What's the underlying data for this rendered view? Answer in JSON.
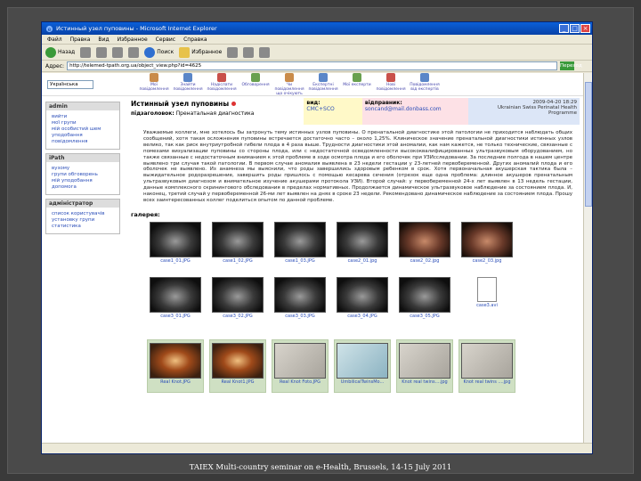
{
  "window": {
    "title": "Истинный узел пуповины - Microsoft Internet Explorer"
  },
  "menu": [
    "Файл",
    "Правка",
    "Вид",
    "Избранное",
    "Сервис",
    "Справка"
  ],
  "toolbar": {
    "back": "Назад",
    "search": "Поиск",
    "favorites": "Избранное"
  },
  "address": {
    "label": "Адрес:",
    "url": "http://telemed-tpath.org.ua/object_view.php?id=4625",
    "go": "Переход"
  },
  "site": {
    "language": "Українська",
    "nav": [
      "Мої повідомлення",
      "Знайти повідомлення",
      "Надіслати повідомлення",
      "Обговорення",
      "Чи повідомлення що очікують",
      "Експертні повідомлення",
      "Мої експерти",
      "Нові повідомлення",
      "Повідомлення від експертів"
    ]
  },
  "sidebar": [
    {
      "title": "admin",
      "items": [
        "вийти",
        "мої групи",
        "мій особистий шем",
        "уподобання",
        "повідомлення"
      ]
    },
    {
      "title": "iPath",
      "items": [
        "вузому",
        "групи обговорень",
        "мій уподобання",
        "допомога"
      ]
    },
    {
      "title": "адміністратор",
      "items": [
        "список користувачів",
        "установку групи",
        "статистика"
      ]
    }
  ],
  "header": {
    "title": "Истинный узел пуповины",
    "subtitle_label": "підзаголовок:",
    "subtitle": "Пренатальная диагностика",
    "view_label": "вид:",
    "view_value": "CMC+SCO",
    "sender_label": "відправник:",
    "sender_value": "soncand@mail.donbass.com",
    "date": "2009-04-20 18:29",
    "org": "Ukrainian Swiss Perinatal Health Programme"
  },
  "body": "Уважаемые коллеги, мне хотелось бы затронуть тему истинных узлов пуповины. О пренатальной диагностике этой патологии не приходится наблюдать общих сообщений, хотя такая осложнения пуповины встречается достаточно часто – около 1,25%. Клиническое значение пренатальной диагностики истинных узлов велико, так как риск внутриутробной гибели плода в 4 раза выше. Трудности диагностики этой аномалии, как нам кажется, не только технические, связанные с помехами визуализации пуповины со стороны плода, или с недостаточной осведомленности высококвалифицированных ультразвуковым оборудованием, но также связанные с недостаточным вниманием к этой проблеме в ходе осмотра плода и его оболочек при УЗИсследовании. За последние полгода в нашем центре выявлено три случая такой патологии. В первом случае аномалия выявлена в 23 недели гестации у 23-летней первобеременной. Других аномалий плода и его оболочек не выявлено. Из анамнеза мы выяснили, что роды завершились здоровым ребенком в срок. Хотя первоначальная акушерская тактика была – выжидательное родоразрешение, завершить роды пришлось с помощью кесарева сечения (отрезок еще одна проблема: длинное акушеров пренатальным ультразвуковым диагнозом и внимательное изучение акушерами протокола УЗИ). Второй случай: у первобеременной 24-х лет выявлен в 13 недель гестации, данные комплексного скринингового обследования в пределах нормативных. Продолжается динамическое ультразвуковое наблюдение за состоянием плода. И, наконец, третий случай у первобеременной 26-ми лет выявлен на днях в сроке 23 недели. Рекомендовано динамическое наблюдение за состоянием плода. Прошу всех заинтересованных коллег поделиться опытом по данной проблеме.",
  "gallery": {
    "label": "галерея:",
    "row1": [
      "case1_01.JPG",
      "case1_02.JPG",
      "case1_03.JPG",
      "case2_01.jpg",
      "case2_02.jpg",
      "case2_03.jpg"
    ],
    "row2": [
      "case3_01.JPG",
      "case3_02.JPG",
      "case3_03.JPG",
      "case3_04.JPG",
      "case3_05.JPG"
    ],
    "doc": "case3.avi",
    "row3": [
      "Real Knot.JPG",
      "Real Knot1.JPG",
      "Real Knot Foto.JPG",
      "UmbilicalTwinsMo...",
      "Knot real twins....jpg",
      "Knot real twins ....jpg"
    ]
  },
  "footer": "TAIEX Multi-country seminar on e-Health, Brussels, 14-15 July 2011"
}
